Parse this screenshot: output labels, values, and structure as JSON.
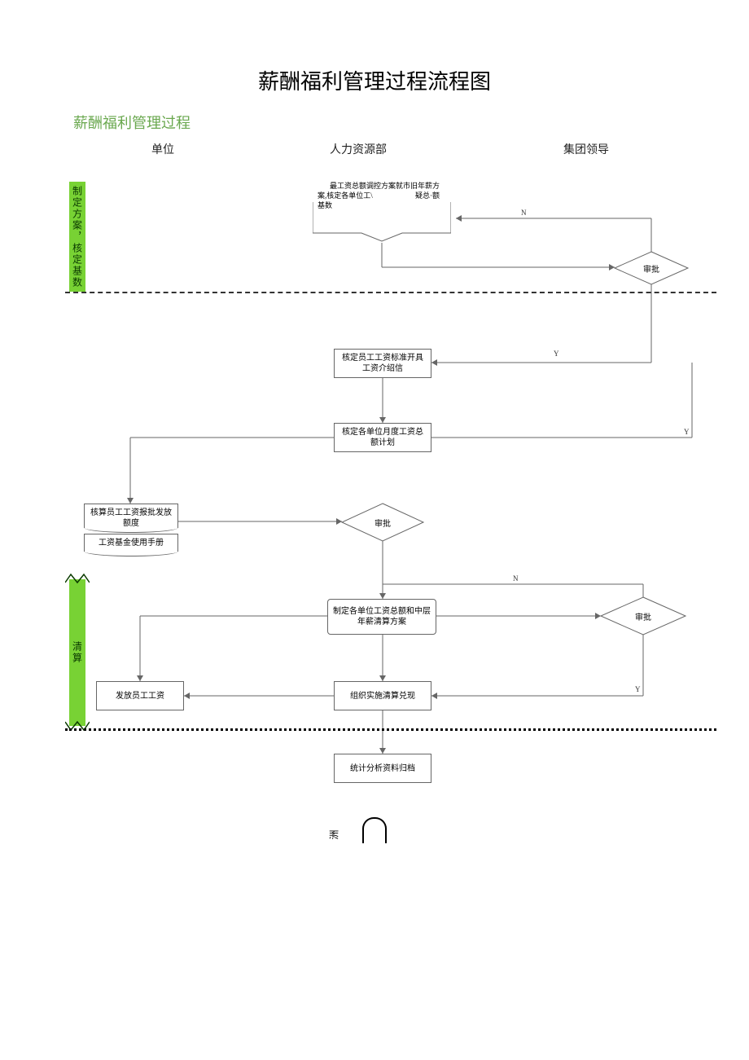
{
  "title": "薪酬福利管理过程流程图",
  "subtitle": "薪酬福利管理过程",
  "columns": {
    "unit": "单位",
    "hr": "人力资源部",
    "leader": "集团领导"
  },
  "phase_labels": {
    "phase1": "制定方案，核定基数",
    "phase2": "清算"
  },
  "nodes": {
    "p1_text_a": "最工资总额调控方案就市旧年薪方",
    "p1_text_b": "案,核定各单位工\\",
    "p1_text_c": "疑总·额",
    "p1_text_d": "基数",
    "approve": "审批",
    "b1": "核定员工工资标准开具工资介绍信",
    "b2": "核定各单位月度工资总额计划",
    "b3a": "核算员工工资报批发放额度",
    "b3b": "工资基金使用手册",
    "b4": "制定各单位工资总额和中层年薪清算方案",
    "b5": "发放员工工资",
    "b6": "组织实施清算兑现",
    "b7": "统计分析资料归档"
  },
  "edge_labels": {
    "y": "Y",
    "n": "N"
  },
  "footnote": "洲"
}
